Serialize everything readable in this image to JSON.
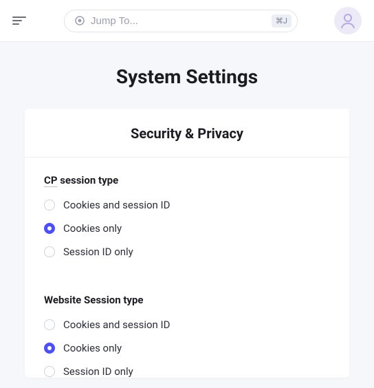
{
  "header": {
    "search_placeholder": "Jump To...",
    "shortcut": "⌘J"
  },
  "page_title": "System Settings",
  "card": {
    "title": "Security & Privacy",
    "fields": [
      {
        "label_prefix_abbr": "CP",
        "label_rest": " session type",
        "options": [
          {
            "label": "Cookies and session ID",
            "checked": false
          },
          {
            "label": "Cookies only",
            "checked": true
          },
          {
            "label": "Session ID only",
            "checked": false
          }
        ]
      },
      {
        "label": "Website Session type",
        "options": [
          {
            "label": "Cookies and session ID",
            "checked": false
          },
          {
            "label": "Cookies only",
            "checked": true
          },
          {
            "label": "Session ID only",
            "checked": false
          }
        ]
      }
    ]
  }
}
